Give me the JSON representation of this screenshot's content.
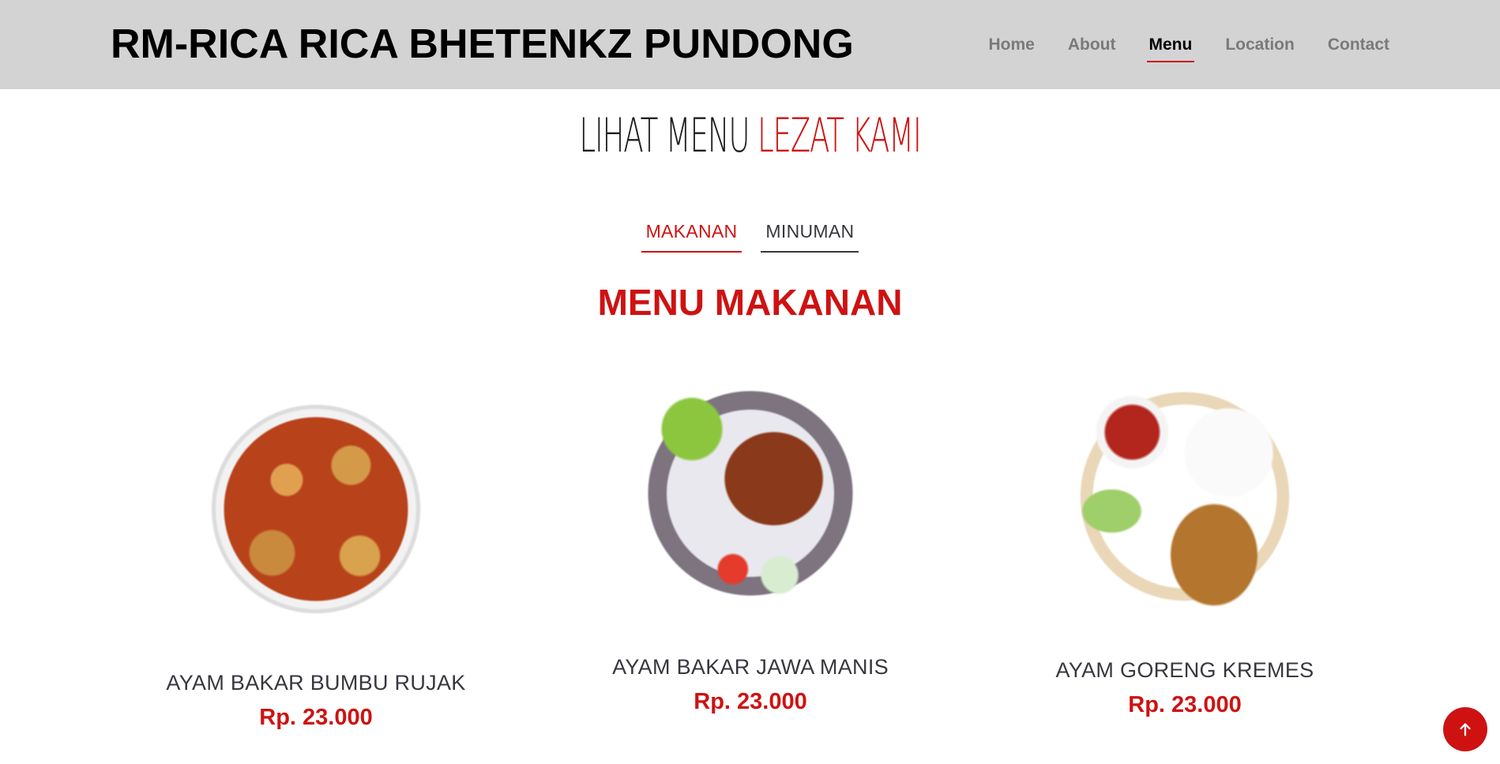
{
  "header": {
    "logo": "RM-RICA RICA BHETENKZ PUNDONG",
    "nav": [
      {
        "label": "Home"
      },
      {
        "label": "About"
      },
      {
        "label": "Menu"
      },
      {
        "label": "Location"
      },
      {
        "label": "Contact"
      }
    ],
    "active_nav": "Menu"
  },
  "section": {
    "title_part1": "LIHAT MENU",
    "title_accent": "LEZAT KAMI"
  },
  "tabs": [
    {
      "label": "MAKANAN"
    },
    {
      "label": "MINUMAN"
    }
  ],
  "active_tab": "MAKANAN",
  "menu_heading": "MENU MAKANAN",
  "items": [
    {
      "name": "AYAM BAKAR BUMBU RUJAK",
      "price": "Rp. 23.000",
      "image": "ayam-rica-bowl-image"
    },
    {
      "name": "AYAM BAKAR JAWA MANIS",
      "price": "Rp. 23.000",
      "image": "ayam-bakar-plate-image"
    },
    {
      "name": "AYAM GORENG KREMES",
      "price": "Rp. 23.000",
      "image": "ayam-goreng-plate-image"
    }
  ],
  "scroll_top_icon": "arrow-up-icon",
  "colors": {
    "accent": "#ce1212",
    "header_bg": "#d3d3d3",
    "text_dark": "#37373f"
  }
}
